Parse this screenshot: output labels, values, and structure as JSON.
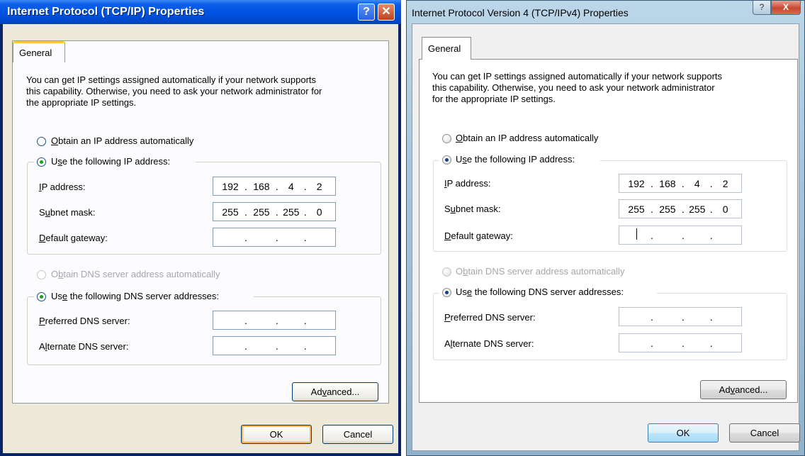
{
  "xp": {
    "title": "Internet Protocol (TCP/IP) Properties",
    "help_glyph": "?",
    "close_glyph": "✕",
    "tab": "General",
    "intro": [
      "You can get IP settings assigned automatically if your network supports",
      "this capability. Otherwise, you need to ask your network administrator for",
      "the appropriate IP settings."
    ],
    "radio_auto_ip": {
      "access": "O",
      "rest": "btain an IP address automatically"
    },
    "radio_use_ip": {
      "pre": "U",
      "access": "s",
      "rest": "e the following IP address:"
    },
    "ip_label": {
      "access": "I",
      "rest": "P address:"
    },
    "subnet_label": {
      "pre": "S",
      "access": "u",
      "rest": "bnet mask:"
    },
    "gateway_label": {
      "access": "D",
      "rest": "efault gateway:"
    },
    "ip_address": [
      "192",
      "168",
      "4",
      "2"
    ],
    "subnet_mask": [
      "255",
      "255",
      "255",
      "0"
    ],
    "gateway": [
      "",
      "",
      "",
      ""
    ],
    "radio_auto_dns": {
      "pre": "O",
      "access": "b",
      "rest": "tain DNS server address automatically"
    },
    "radio_use_dns": {
      "pre": "Us",
      "access": "e",
      "rest": " the following DNS server addresses:"
    },
    "pref_dns_label": {
      "access": "P",
      "rest": "referred DNS server:"
    },
    "alt_dns_label": {
      "pre": "A",
      "access": "l",
      "rest": "ternate DNS server:"
    },
    "advanced_button": {
      "pre": "Ad",
      "access": "v",
      "rest": "anced..."
    },
    "ok_button": "OK",
    "cancel_button": "Cancel",
    "colors": {
      "title_bar": "#0054e3",
      "dialog_bg": "#ece9d8",
      "radio_dot": "#21a121"
    }
  },
  "vista": {
    "title": "Internet Protocol Version 4 (TCP/IPv4) Properties",
    "help_glyph": "?",
    "close_glyph": "X",
    "tab": "General",
    "intro": [
      "You can get IP settings assigned automatically if your network supports",
      "this capability. Otherwise, you need to ask your network administrator",
      "for the appropriate IP settings."
    ],
    "radio_auto_ip": {
      "access": "O",
      "rest": "btain an IP address automatically"
    },
    "radio_use_ip": {
      "pre": "U",
      "access": "s",
      "rest": "e the following IP address:"
    },
    "ip_label": {
      "access": "I",
      "rest": "P address:"
    },
    "subnet_label": {
      "pre": "S",
      "access": "u",
      "rest": "bnet mask:"
    },
    "gateway_label": {
      "access": "D",
      "rest": "efault gateway:"
    },
    "ip_address": [
      "192",
      "168",
      "4",
      "2"
    ],
    "subnet_mask": [
      "255",
      "255",
      "255",
      "0"
    ],
    "gateway": [
      "",
      "",
      "",
      ""
    ],
    "radio_auto_dns": {
      "pre": "O",
      "access": "b",
      "rest": "tain DNS server address automatically"
    },
    "radio_use_dns": {
      "pre": "Us",
      "access": "e",
      "rest": " the following DNS server addresses:"
    },
    "pref_dns_label": {
      "access": "P",
      "rest": "referred DNS server:"
    },
    "alt_dns_label": {
      "pre": "A",
      "access": "l",
      "rest": "ternate DNS server:"
    },
    "advanced_button": {
      "pre": "Ad",
      "access": "v",
      "rest": "anced..."
    },
    "ok_button": "OK",
    "cancel_button": "Cancel",
    "colors": {
      "title_bar": "#a7c6dd",
      "dialog_bg": "#f0f0f0",
      "radio_dot": "#1b3f77"
    }
  }
}
